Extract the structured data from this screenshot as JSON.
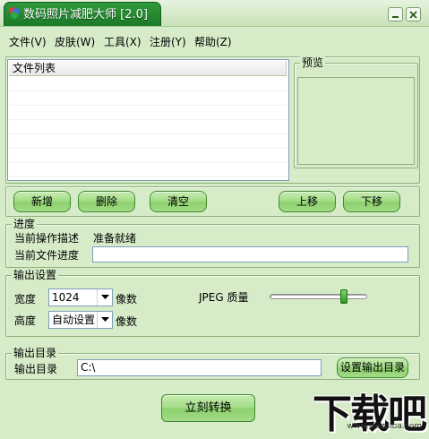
{
  "window": {
    "title": "数码照片减肥大师 [2.0]",
    "accent_color": "#1e7f2a",
    "background_color": "#d6ecc9"
  },
  "menu": [
    {
      "label": "文件(V)"
    },
    {
      "label": "皮肤(W)"
    },
    {
      "label": "工具(X)"
    },
    {
      "label": "注册(Y)"
    },
    {
      "label": "帮助(Z)"
    }
  ],
  "file_list": {
    "header": "文件列表",
    "rows": []
  },
  "preview": {
    "legend": "预览"
  },
  "buttons": {
    "add": "新增",
    "delete": "删除",
    "clear": "清空",
    "move_up": "上移",
    "move_down": "下移",
    "set_output_dir": "设置输出目录",
    "convert": "立刻转换"
  },
  "progress": {
    "legend": "进度",
    "current_op_label": "当前操作描述",
    "current_op_value": "准备就绪",
    "file_progress_label": "当前文件进度",
    "file_progress_value": 0
  },
  "output_settings": {
    "legend": "输出设置",
    "width_label": "宽度",
    "width_value": "1024",
    "height_label": "高度",
    "height_value": "自动设置",
    "unit": "像数",
    "jpeg_quality_label": "JPEG 质量",
    "jpeg_quality_fraction": 0.78
  },
  "output_dir": {
    "legend": "输出目录",
    "label": "输出目录",
    "value": "C:\\"
  },
  "watermark": {
    "main": "下载吧",
    "sub": "www.xiazaiba.com"
  }
}
